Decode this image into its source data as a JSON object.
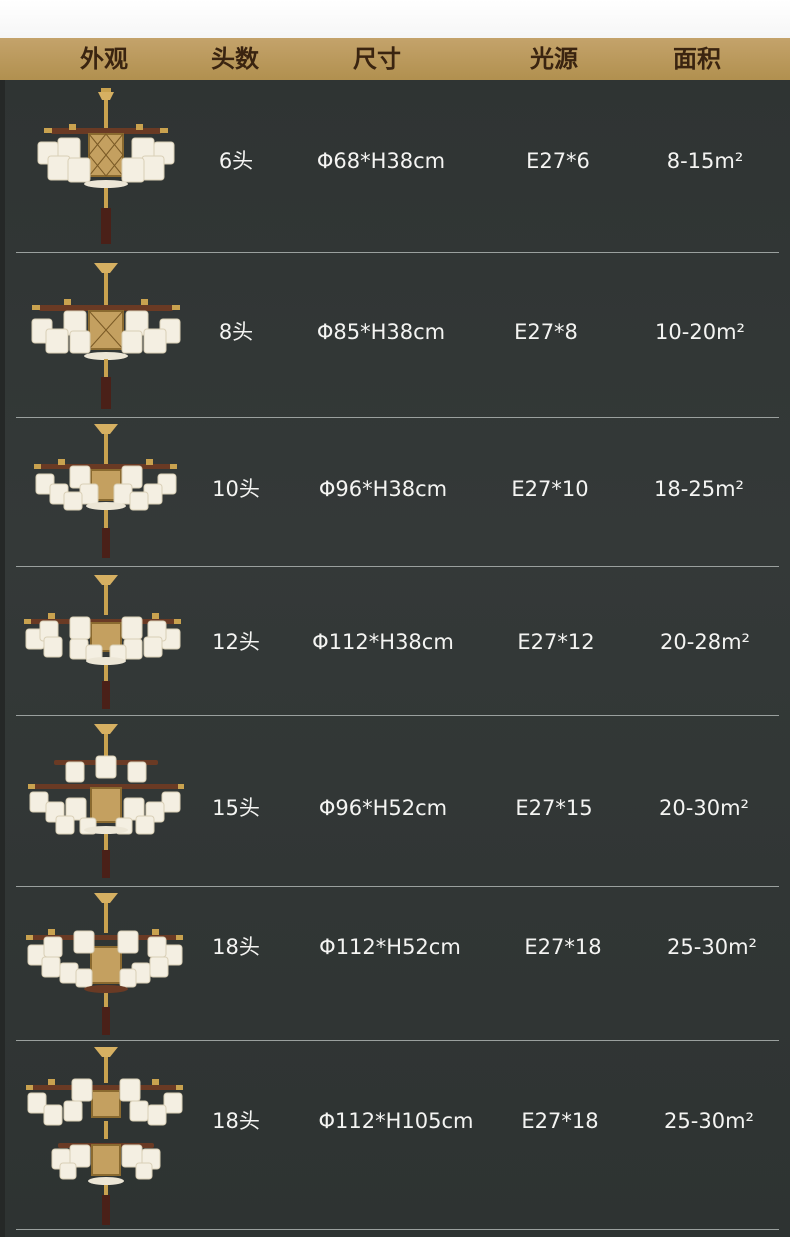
{
  "header": {
    "col_appearance": "外观",
    "col_heads": "头数",
    "col_size": "尺寸",
    "col_light": "光源",
    "col_area": "面积"
  },
  "rows": [
    {
      "heads": "6头",
      "size": "Φ68*H38cm",
      "light": "E27*6",
      "area": "8-15m²"
    },
    {
      "heads": "8头",
      "size": "Φ85*H38cm",
      "light": "E27*8",
      "area": "10-20m²"
    },
    {
      "heads": "10头",
      "size": "Φ96*H38cm",
      "light": "E27*10",
      "area": "18-25m²"
    },
    {
      "heads": "12头",
      "size": "Φ112*H38cm",
      "light": "E27*12",
      "area": "20-28m²"
    },
    {
      "heads": "15头",
      "size": "Φ96*H52cm",
      "light": "E27*15",
      "area": "20-30m²"
    },
    {
      "heads": "18头",
      "size": "Φ112*H52cm",
      "light": "E27*18",
      "area": "25-30m²"
    },
    {
      "heads": "18头",
      "size": "Φ112*H105cm",
      "light": "E27*18",
      "area": "25-30m²"
    }
  ],
  "images": [
    {
      "icon": "chandelier-6-heads-image"
    },
    {
      "icon": "chandelier-8-heads-image"
    },
    {
      "icon": "chandelier-10-heads-image"
    },
    {
      "icon": "chandelier-12-heads-image"
    },
    {
      "icon": "chandelier-15-heads-image"
    },
    {
      "icon": "chandelier-18-heads-image"
    },
    {
      "icon": "chandelier-18-heads-tall-image"
    }
  ],
  "colors": {
    "header_bg": "#b99957",
    "header_text": "#3a2410",
    "body_bg": "#2f3332",
    "text": "#f4f4f2",
    "divider": "#9aa09e"
  }
}
